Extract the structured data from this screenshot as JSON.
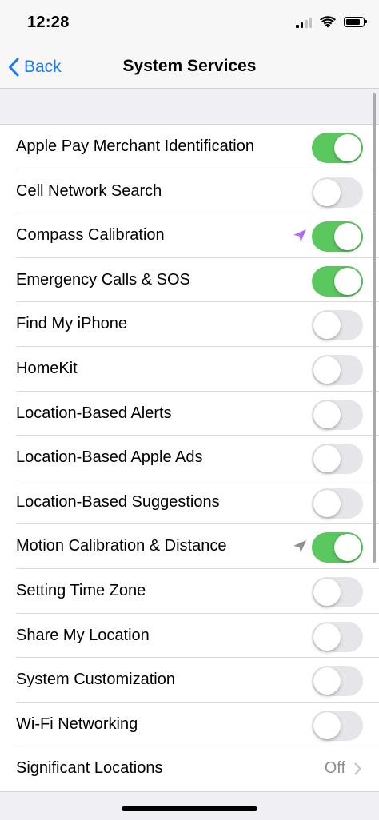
{
  "status_bar": {
    "time": "12:28",
    "icons": [
      "signal-icon",
      "wifi-icon",
      "battery-icon"
    ]
  },
  "nav": {
    "back_label": "Back",
    "title": "System Services"
  },
  "colors": {
    "accent": "#1a7cf5",
    "toggle_on": "#5ac85f",
    "toggle_off": "#e6e6ea",
    "location_purple": "#b06cf0",
    "location_gray": "#8e8e93"
  },
  "services": [
    {
      "label": "Apple Pay Merchant Identification",
      "on": true,
      "location_icon": null
    },
    {
      "label": "Cell Network Search",
      "on": false,
      "location_icon": null
    },
    {
      "label": "Compass Calibration",
      "on": true,
      "location_icon": "purple"
    },
    {
      "label": "Emergency Calls & SOS",
      "on": true,
      "location_icon": null
    },
    {
      "label": "Find My iPhone",
      "on": false,
      "location_icon": null
    },
    {
      "label": "HomeKit",
      "on": false,
      "location_icon": null
    },
    {
      "label": "Location-Based Alerts",
      "on": false,
      "location_icon": null
    },
    {
      "label": "Location-Based Apple Ads",
      "on": false,
      "location_icon": null
    },
    {
      "label": "Location-Based Suggestions",
      "on": false,
      "location_icon": null
    },
    {
      "label": "Motion Calibration & Distance",
      "on": true,
      "location_icon": "gray"
    },
    {
      "label": "Setting Time Zone",
      "on": false,
      "location_icon": null
    },
    {
      "label": "Share My Location",
      "on": false,
      "location_icon": null
    },
    {
      "label": "System Customization",
      "on": false,
      "location_icon": null
    },
    {
      "label": "Wi-Fi Networking",
      "on": false,
      "location_icon": null
    }
  ],
  "significant_locations": {
    "label": "Significant Locations",
    "value": "Off"
  }
}
